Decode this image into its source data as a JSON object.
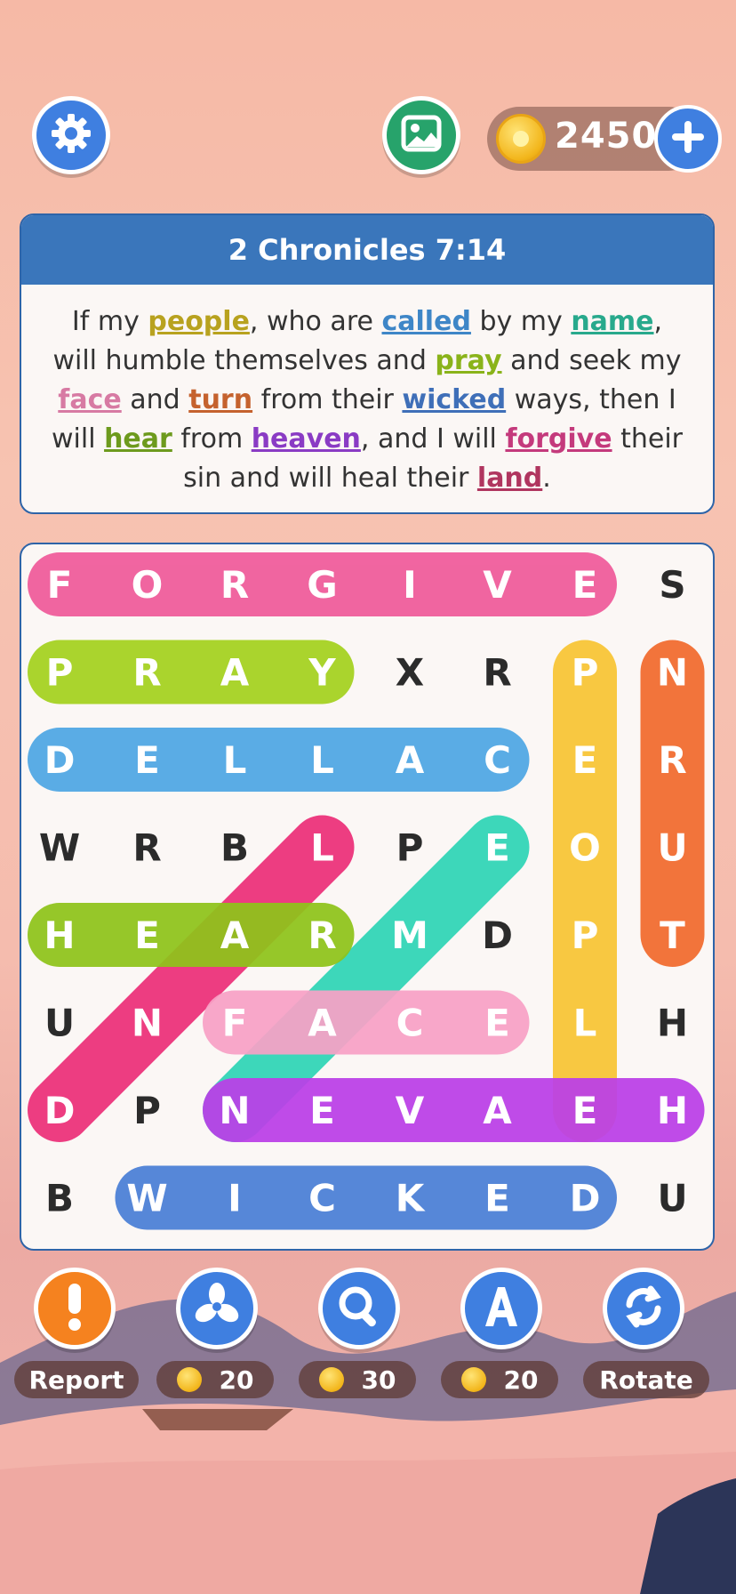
{
  "coins": "2450",
  "verse": {
    "reference": "2 Chronicles 7:14",
    "segments": [
      {
        "t": "If my "
      },
      {
        "t": "people",
        "c": "#b8a21f"
      },
      {
        "t": ", who are "
      },
      {
        "t": "called",
        "c": "#3e86c7"
      },
      {
        "t": " by my "
      },
      {
        "t": "name",
        "c": "#28a98c"
      },
      {
        "t": ", will humble themselves and "
      },
      {
        "t": "pray",
        "c": "#8ab31a"
      },
      {
        "t": " and seek my "
      },
      {
        "t": "face",
        "c": "#d77aa3"
      },
      {
        "t": " and "
      },
      {
        "t": "turn",
        "c": "#c5622e"
      },
      {
        "t": " from their "
      },
      {
        "t": "wicked",
        "c": "#3f6fb8"
      },
      {
        "t": " ways, then I will "
      },
      {
        "t": "hear",
        "c": "#6d9a1d"
      },
      {
        "t": " from "
      },
      {
        "t": "heaven",
        "c": "#8a3bc4"
      },
      {
        "t": ", and I will "
      },
      {
        "t": "forgive",
        "c": "#c43a7c"
      },
      {
        "t": " their sin and will heal their "
      },
      {
        "t": "land",
        "c": "#b0355f"
      },
      {
        "t": "."
      }
    ]
  },
  "grid": {
    "rows": [
      [
        "F",
        "O",
        "R",
        "G",
        "I",
        "V",
        "E",
        "S"
      ],
      [
        "P",
        "R",
        "A",
        "Y",
        "X",
        "R",
        "P",
        "N"
      ],
      [
        "D",
        "E",
        "L",
        "L",
        "A",
        "C",
        "E",
        "R"
      ],
      [
        "W",
        "R",
        "B",
        "L",
        "P",
        "E",
        "O",
        "U"
      ],
      [
        "H",
        "E",
        "A",
        "R",
        "M",
        "D",
        "P",
        "T"
      ],
      [
        "U",
        "N",
        "F",
        "A",
        "C",
        "E",
        "L",
        "H"
      ],
      [
        "D",
        "P",
        "N",
        "E",
        "V",
        "A",
        "E",
        "H"
      ],
      [
        "B",
        "W",
        "I",
        "C",
        "K",
        "E",
        "D",
        "U"
      ]
    ],
    "found": [
      {
        "word": "FORGIVE",
        "from": [
          0,
          0
        ],
        "to": [
          0,
          6
        ],
        "color": "#f05a9a"
      },
      {
        "word": "PRAY",
        "from": [
          1,
          0
        ],
        "to": [
          1,
          3
        ],
        "color": "#a4d21e"
      },
      {
        "word": "CALLED",
        "from": [
          2,
          5
        ],
        "to": [
          2,
          0
        ],
        "color": "#4ea7e4"
      },
      {
        "word": "PEOPLE",
        "from": [
          1,
          6
        ],
        "to": [
          6,
          6
        ],
        "color": "#f8c534"
      },
      {
        "word": "TURN",
        "from": [
          4,
          7
        ],
        "to": [
          1,
          7
        ],
        "color": "#f26b2e"
      },
      {
        "word": "LAND",
        "from": [
          3,
          3
        ],
        "to": [
          6,
          0
        ],
        "color": "#ec2f79"
      },
      {
        "word": "NAME",
        "from": [
          6,
          2
        ],
        "to": [
          3,
          5
        ],
        "color": "#2fd5b6"
      },
      {
        "word": "HEAR",
        "from": [
          4,
          0
        ],
        "to": [
          4,
          3
        ],
        "color": "#8fc41a"
      },
      {
        "word": "FACE",
        "from": [
          5,
          2
        ],
        "to": [
          5,
          5
        ],
        "color": "#f8a2c6"
      },
      {
        "word": "HEAVEN",
        "from": [
          6,
          7
        ],
        "to": [
          6,
          2
        ],
        "color": "#bb3fe8"
      },
      {
        "word": "WICKED",
        "from": [
          7,
          1
        ],
        "to": [
          7,
          6
        ],
        "color": "#4a7fd6"
      }
    ]
  },
  "tools": [
    {
      "name": "report",
      "label": "Report",
      "icon": "exclamation-icon",
      "color": "#f5821f"
    },
    {
      "name": "fan",
      "cost": "20",
      "icon": "fan-icon",
      "color": "#3f7fe0"
    },
    {
      "name": "magnifier",
      "cost": "30",
      "icon": "magnifier-icon",
      "color": "#3f7fe0"
    },
    {
      "name": "letter",
      "cost": "20",
      "icon": "letter-a-icon",
      "color": "#3f7fe0"
    },
    {
      "name": "rotate",
      "label": "Rotate",
      "icon": "rotate-icon",
      "color": "#3f7fe0"
    }
  ]
}
